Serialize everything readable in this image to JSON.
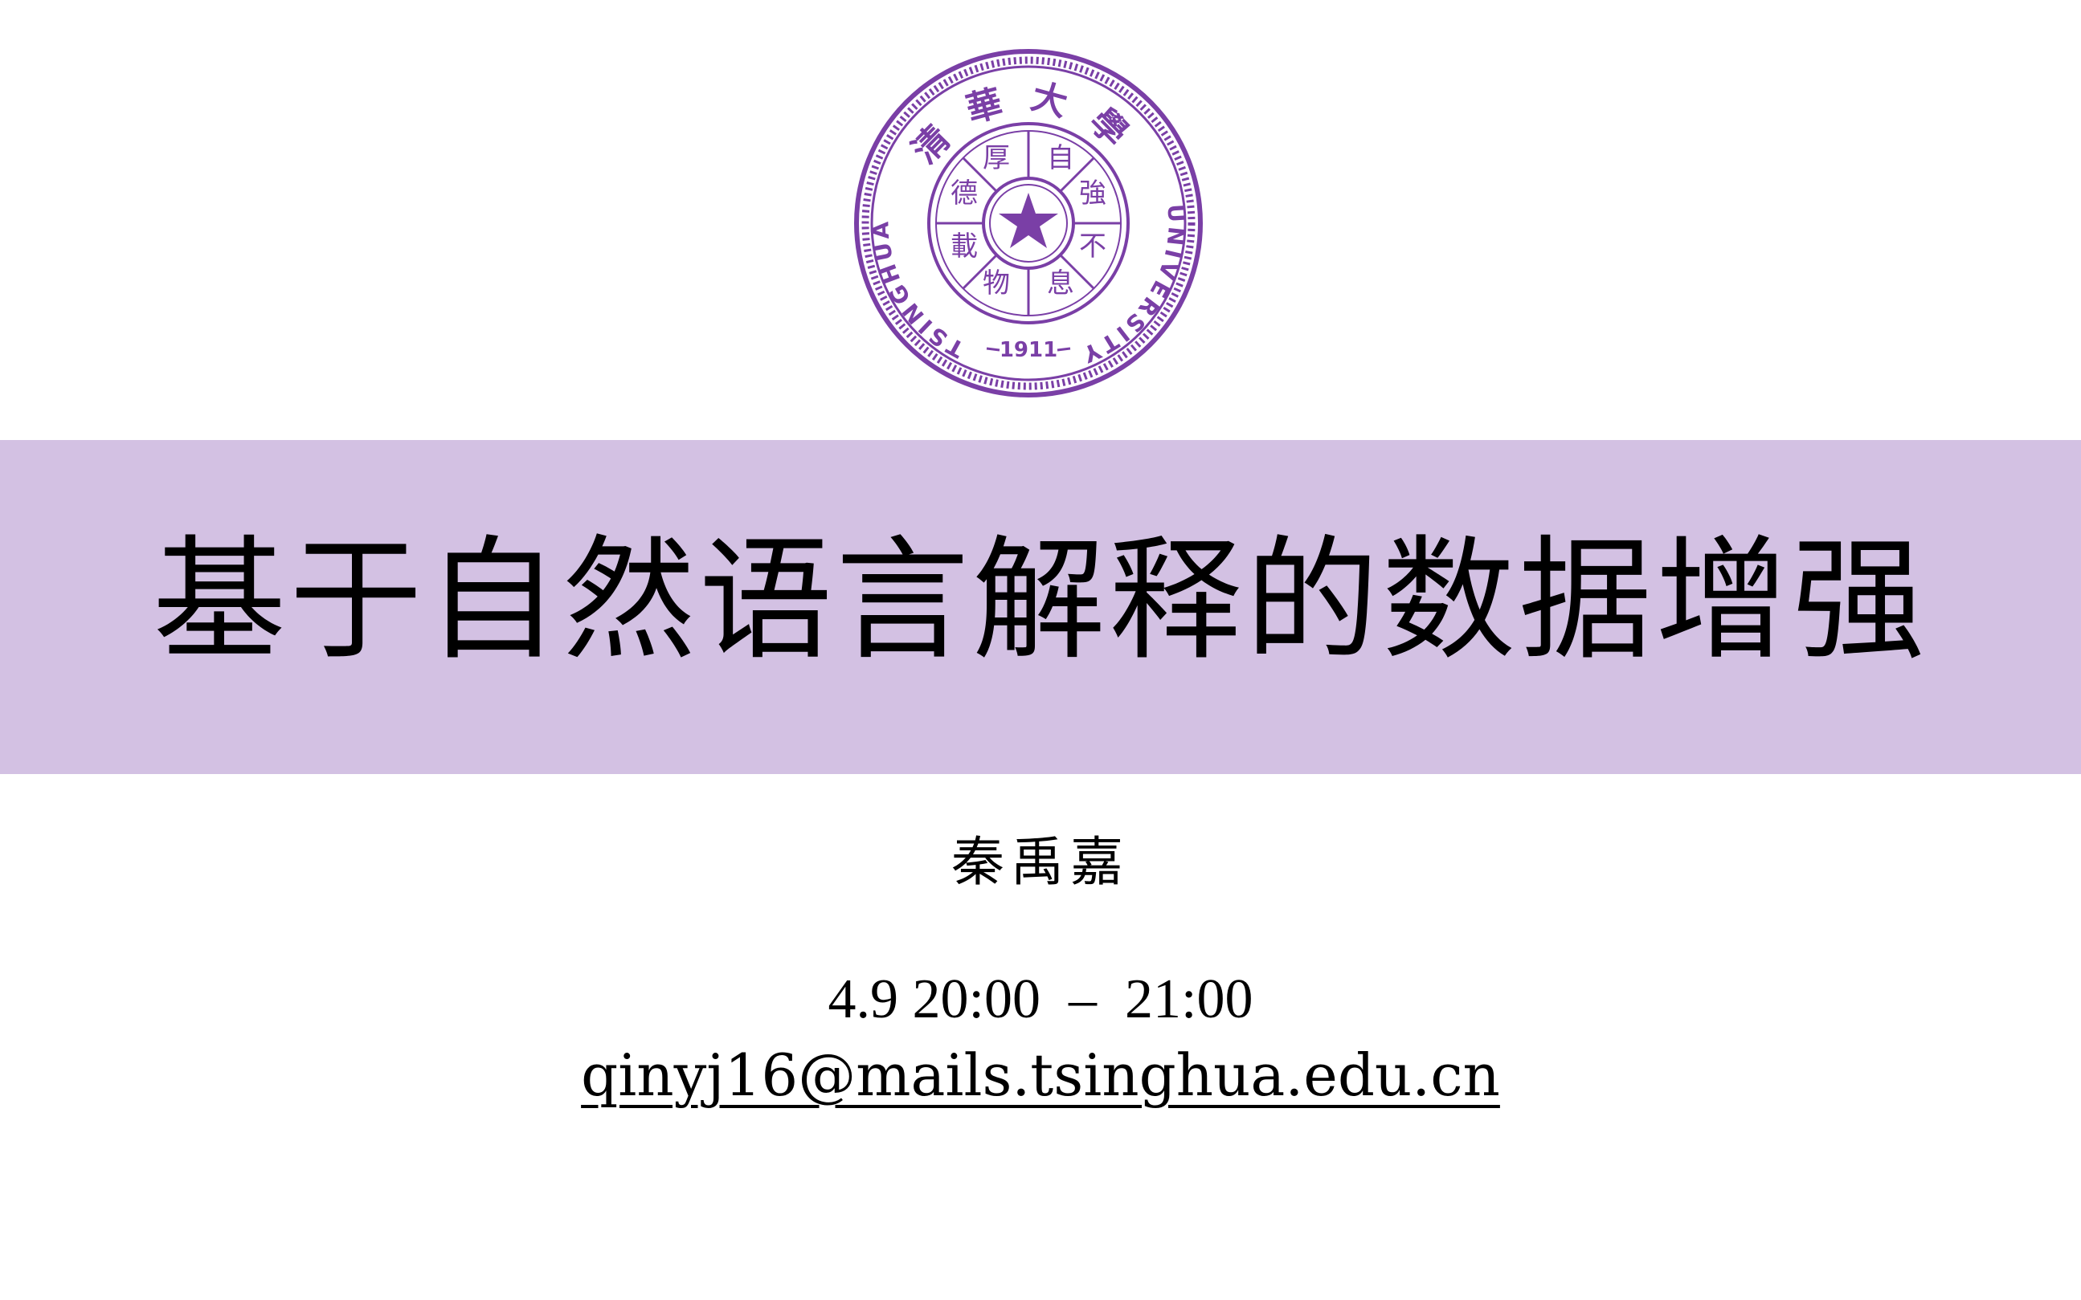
{
  "logo": {
    "name": "tsinghua-university-seal",
    "top_text": "清華大學",
    "left_text": "TSINGHUA",
    "right_text": "UNIVERSITY",
    "year": "1911",
    "inner_text": [
      "自",
      "強",
      "不",
      "息",
      "厚",
      "德",
      "載",
      "物"
    ],
    "color": "#7a3fa6"
  },
  "slide": {
    "title": "基于自然语言解释的数据增强",
    "author": "秦禹嘉",
    "time": "4.9 20:00  –  21:00",
    "email": "qinyj16@mails.tsinghua.edu.cn"
  },
  "colors": {
    "band": "#d3c1e3",
    "seal": "#7a3fa6",
    "text": "#000000"
  }
}
